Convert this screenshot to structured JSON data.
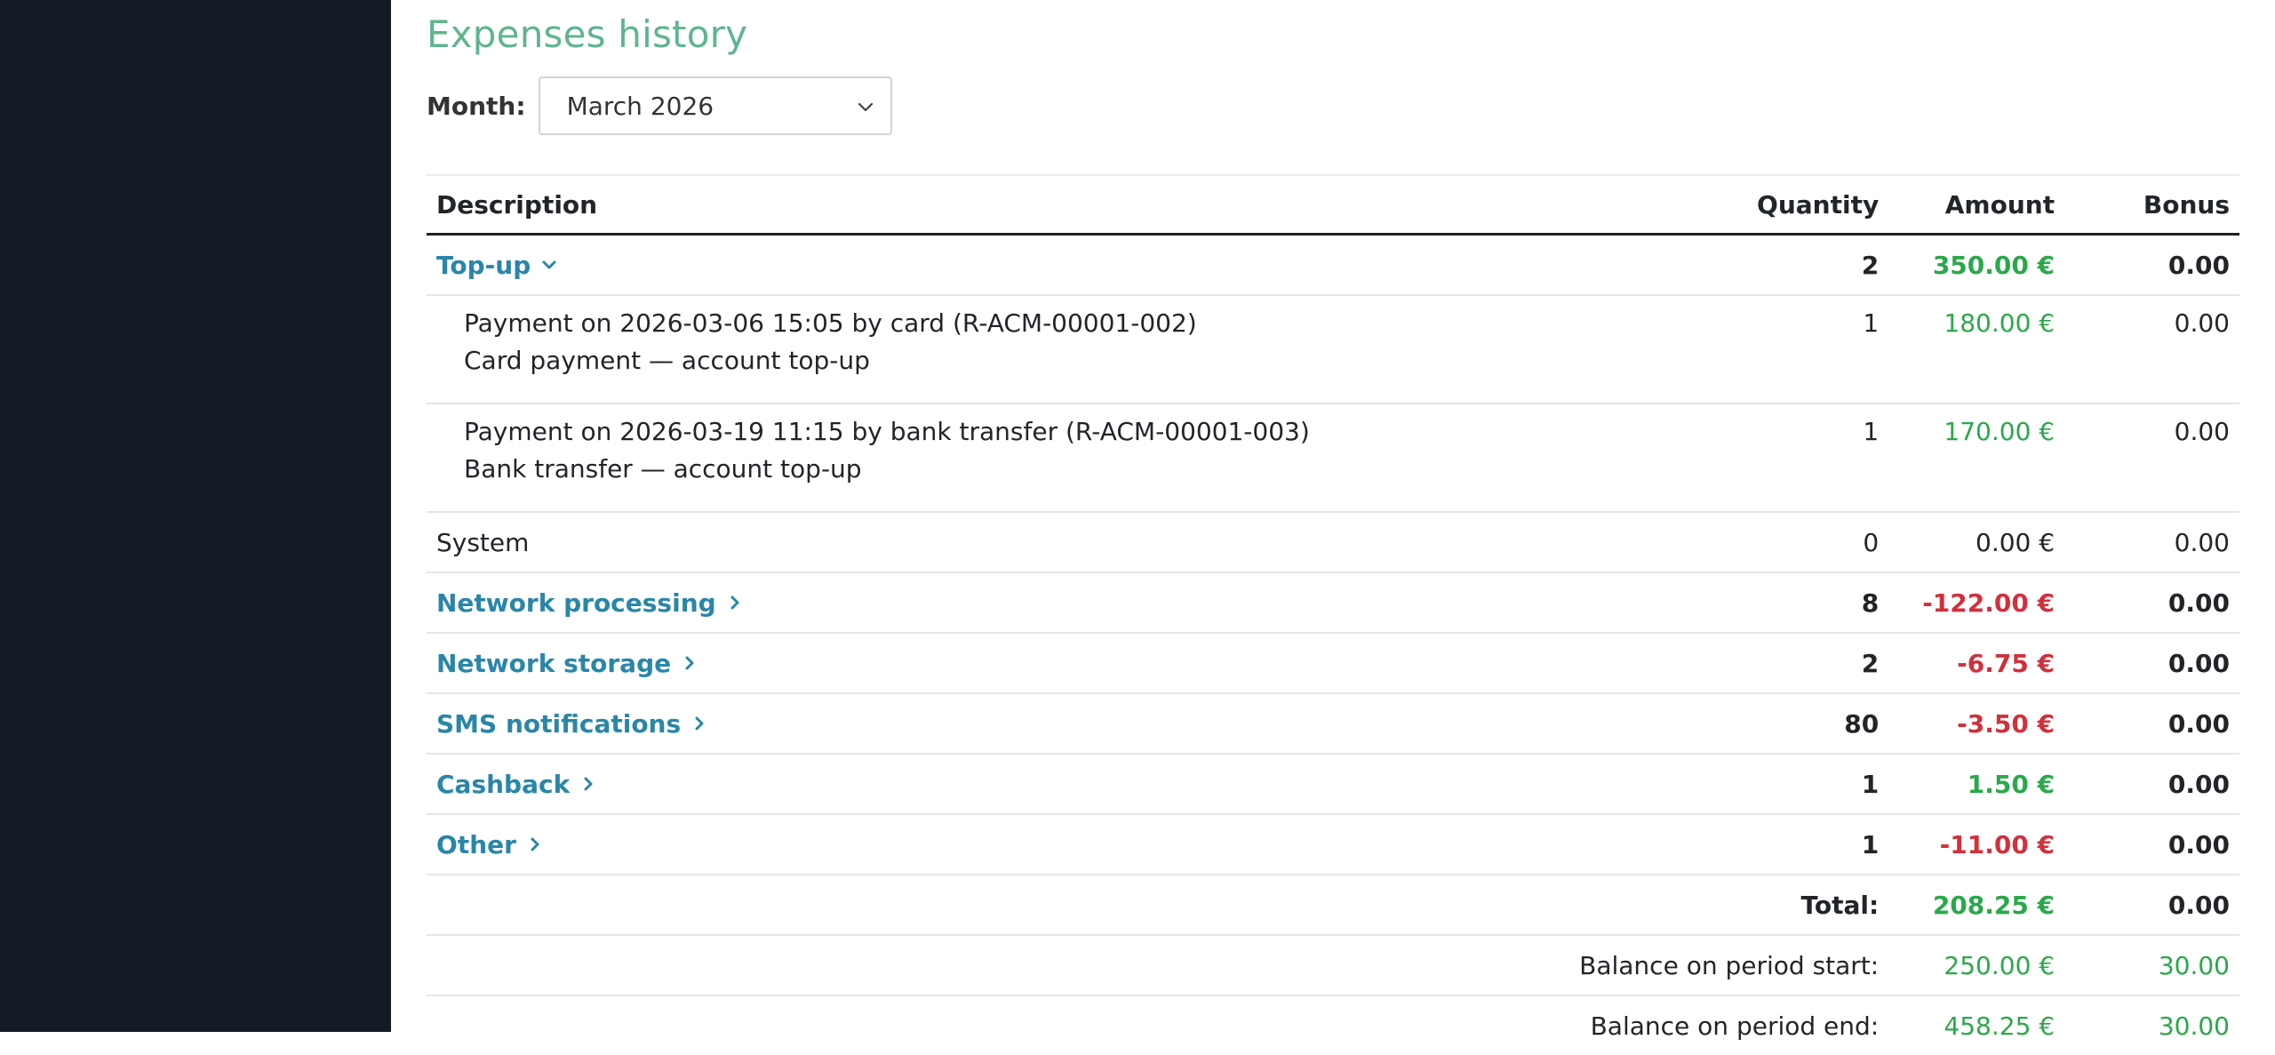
{
  "page": {
    "title": "Expenses history"
  },
  "filter": {
    "month_label": "Month:",
    "month_value": "March 2026"
  },
  "table": {
    "headers": {
      "description": "Description",
      "quantity": "Quantity",
      "amount": "Amount",
      "bonus": "Bonus"
    },
    "rows": {
      "topup": {
        "label": "Top-up",
        "quantity": "2",
        "amount": "350.00 €",
        "bonus": "0.00",
        "expanded": true
      },
      "topup_items": [
        {
          "line1": "Payment on 2026-03-06 15:05 by card (R-ACM-00001-002)",
          "line2": "Card payment — account top-up",
          "quantity": "1",
          "amount": "180.00 €",
          "bonus": "0.00"
        },
        {
          "line1": "Payment on 2026-03-19 11:15 by bank transfer (R-ACM-00001-003)",
          "line2": "Bank transfer — account top-up",
          "quantity": "1",
          "amount": "170.00 €",
          "bonus": "0.00"
        }
      ],
      "system": {
        "label": "System",
        "quantity": "0",
        "amount": "0.00 €",
        "bonus": "0.00"
      },
      "network_processing": {
        "label": "Network processing",
        "quantity": "8",
        "amount": "-122.00 €",
        "bonus": "0.00"
      },
      "network_storage": {
        "label": "Network storage",
        "quantity": "2",
        "amount": "-6.75 €",
        "bonus": "0.00"
      },
      "sms": {
        "label": "SMS notifications",
        "quantity": "80",
        "amount": "-3.50 €",
        "bonus": "0.00"
      },
      "cashback": {
        "label": "Cashback",
        "quantity": "1",
        "amount": "1.50 €",
        "bonus": "0.00"
      },
      "other": {
        "label": "Other",
        "quantity": "1",
        "amount": "-11.00 €",
        "bonus": "0.00"
      }
    },
    "totals": {
      "total": {
        "label": "Total:",
        "amount": "208.25 €",
        "bonus": "0.00"
      },
      "balance_start": {
        "label": "Balance on period start:",
        "amount": "250.00 €",
        "bonus": "30.00"
      },
      "balance_end": {
        "label": "Balance on period end:",
        "amount": "458.25 €",
        "bonus": "30.00"
      }
    }
  },
  "colors": {
    "sidebar": "#141a23",
    "title": "#5fb58e",
    "link": "#2a86a8",
    "positive": "#2ba84a",
    "negative": "#d0313d"
  }
}
